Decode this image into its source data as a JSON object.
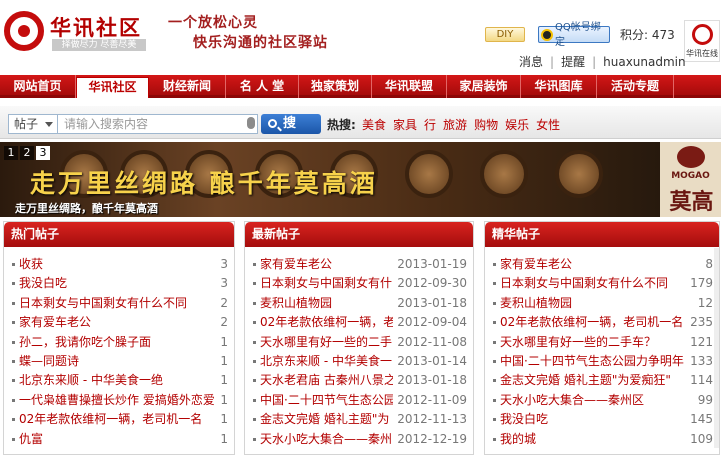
{
  "header": {
    "logo_name": "华讯社区",
    "logo_tag": "择做尽力 尽善尽美",
    "slogan_line1": "一个放松心灵",
    "slogan_line2": "快乐沟通的社区驿站",
    "diy_label": "DIY",
    "qq_label": "QQ帐号绑定",
    "points": "积分: 473",
    "user_logo_text": "华讯在线",
    "links": [
      "消息",
      "提醒",
      "huaxunadmin"
    ]
  },
  "nav": {
    "items": [
      "网站首页",
      "华讯社区",
      "财经新闻",
      "名 人 堂",
      "独家策划",
      "华讯联盟",
      "家居装饰",
      "华讯图库",
      "活动专题"
    ],
    "active_index": 1
  },
  "search": {
    "type": "帖子",
    "placeholder": "请输入搜索内容",
    "button": "搜",
    "hot_label": "热搜:",
    "hot_words": [
      "美食",
      "家具",
      "行",
      "旅游",
      "购物",
      "娱乐",
      "女性"
    ]
  },
  "banner": {
    "title": "走万里丝绸路 酿千年莫高酒",
    "caption": "走万里丝绸路，酿千年莫高酒",
    "pages": [
      "1",
      "2",
      "3"
    ],
    "active_page": 2,
    "brand": "MOGAO",
    "brand_cn": "莫高"
  },
  "panels": [
    {
      "title": "热门帖子",
      "items": [
        {
          "title": "收获",
          "meta": "3"
        },
        {
          "title": "我没白吃",
          "meta": "3"
        },
        {
          "title": "日本剩女与中国剩女有什么不同",
          "meta": "2"
        },
        {
          "title": "家有爱车老公",
          "meta": "2"
        },
        {
          "title": "孙二，我请你吃个臊子面",
          "meta": "1"
        },
        {
          "title": "蝶—同题诗",
          "meta": "1"
        },
        {
          "title": "北京东来顺 - 中华美食一绝",
          "meta": "1"
        },
        {
          "title": "一代枭雄曹操擅长炒作 爱搞婚外恋爱",
          "meta": "1"
        },
        {
          "title": "02年老款依维柯一辆，老司机一名",
          "meta": "1"
        },
        {
          "title": "仇富",
          "meta": "1"
        }
      ]
    },
    {
      "title": "最新帖子",
      "items": [
        {
          "title": "家有爱车老公",
          "meta": "2013-01-19"
        },
        {
          "title": "日本剩女与中国剩女有什",
          "meta": "2012-09-30"
        },
        {
          "title": "麦积山植物园",
          "meta": "2013-01-18"
        },
        {
          "title": "02年老款依维柯一辆，老",
          "meta": "2012-09-04"
        },
        {
          "title": "天水哪里有好一些的二手",
          "meta": "2012-11-08"
        },
        {
          "title": "北京东来顺 - 中华美食一",
          "meta": "2013-01-14"
        },
        {
          "title": "天水老君庙 古秦州八景之",
          "meta": "2013-01-18"
        },
        {
          "title": "中国·二十四节气生态公园",
          "meta": "2012-11-09"
        },
        {
          "title": "金志文完婚 婚礼主题\"为",
          "meta": "2012-11-13"
        },
        {
          "title": "天水小吃大集合——秦州",
          "meta": "2012-12-19"
        }
      ]
    },
    {
      "title": "精华帖子",
      "items": [
        {
          "title": "家有爱车老公",
          "meta": "8"
        },
        {
          "title": "日本剩女与中国剩女有什么不同",
          "meta": "179"
        },
        {
          "title": "麦积山植物园",
          "meta": "12"
        },
        {
          "title": "02年老款依维柯一辆，老司机一名",
          "meta": "235"
        },
        {
          "title": "天水哪里有好一些的二手车？",
          "meta": "121"
        },
        {
          "title": "中国·二十四节气生态公园力争明年",
          "meta": "133"
        },
        {
          "title": "金志文完婚 婚礼主题\"为爱痴狂\"",
          "meta": "114"
        },
        {
          "title": "天水小吃大集合——秦州区",
          "meta": "99"
        },
        {
          "title": "我没白吃",
          "meta": "145"
        },
        {
          "title": "我的城",
          "meta": "109"
        }
      ]
    }
  ]
}
